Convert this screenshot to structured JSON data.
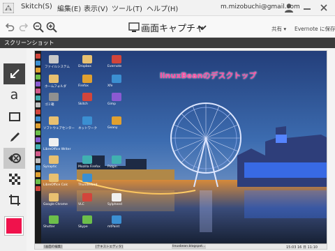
{
  "menubar": {
    "items": [
      "Skitch(S)",
      "編集(E)",
      "表示(V)",
      "ツール(T)",
      "ヘルプ(H)"
    ],
    "account": "m.mizobuchi@gmail.com"
  },
  "toolbar": {
    "title": "画面キャプチャ",
    "share_label": "共有 ▾",
    "save_label": "Evernote に保存"
  },
  "section": {
    "title": "スクリーンショット"
  },
  "palette": {
    "tools": [
      "arrow-tool",
      "text-tool",
      "rectangle-tool",
      "marker-tool",
      "stamp-tool",
      "pixelate-tool",
      "crop-tool"
    ],
    "current_color": "#f0124c"
  },
  "screenshot": {
    "annotation": "linuxBeanのデスクトップ",
    "desktop_icons": [
      "ファイルシステム",
      "ホームフォルダ",
      "ゴミ箱",
      "ソフトウェアセンター",
      "LibreOffice Writer",
      "Synaptic",
      "LibreOffice Calc",
      "Google Chrome",
      "Shutter",
      "Dropbox",
      "Firefox",
      "Skitch",
      "ネットワーク",
      "Mozilla Firefox",
      "Thunderbird",
      "VLC",
      "Skype",
      "Evernote",
      "Xfe",
      "Gimp",
      "Geany",
      "Pidgin",
      "Sylpheed",
      "mtPaint"
    ],
    "taskbar_items": [
      "[画面の編集]",
      "[テキストエディタ]",
      "linuxbean.blogspot..."
    ],
    "clock": "15:03 16 日 11:10"
  },
  "colors": {
    "accent": "#f0124c",
    "annotation": "#ff4aa0",
    "section_bar": "#3b3b3b"
  }
}
